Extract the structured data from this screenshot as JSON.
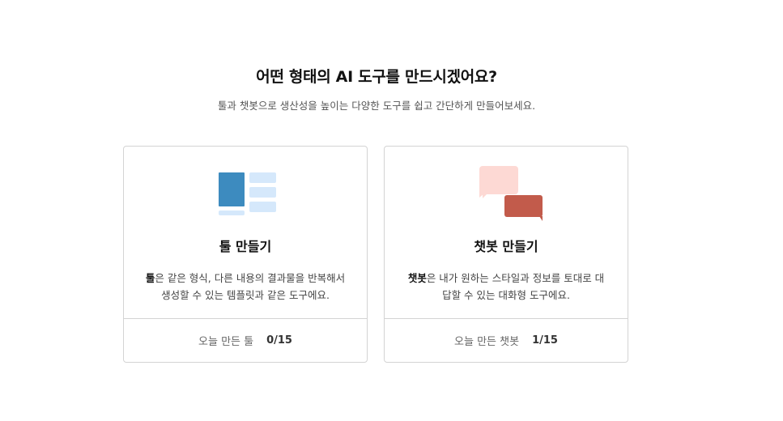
{
  "header": {
    "title": "어떤 형태의 AI 도구를 만드시겠어요?",
    "subtitle": "툴과 챗봇으로 생산성을 높이는 다양한 도구를 쉽고 간단하게 만들어보세요."
  },
  "cards": [
    {
      "title": "툴 만들기",
      "desc_bold": "툴",
      "desc_line1_rest": "은 같은 형식, 다른 내용의 결과물을 반복해서",
      "desc_line2": "생성할 수 있는 템플릿과 같은 도구에요.",
      "footer_label": "오늘 만든 툴",
      "footer_count": "0/15",
      "icon": "tool-layout-icon",
      "colors": {
        "primary": "#3d8bbf",
        "secondary": "#d5e8fb"
      }
    },
    {
      "title": "챗봇 만들기",
      "desc_bold": "챗봇",
      "desc_line1_rest": "은 내가 원하는 스타일과 정보를 토대로 대",
      "desc_line2": "답할 수 있는 대화형 도구에요.",
      "footer_label": "오늘 만든 챗봇",
      "footer_count": "1/15",
      "icon": "chat-bubbles-icon",
      "colors": {
        "primary": "#c25b4b",
        "secondary": "#fdd9d4"
      }
    }
  ]
}
